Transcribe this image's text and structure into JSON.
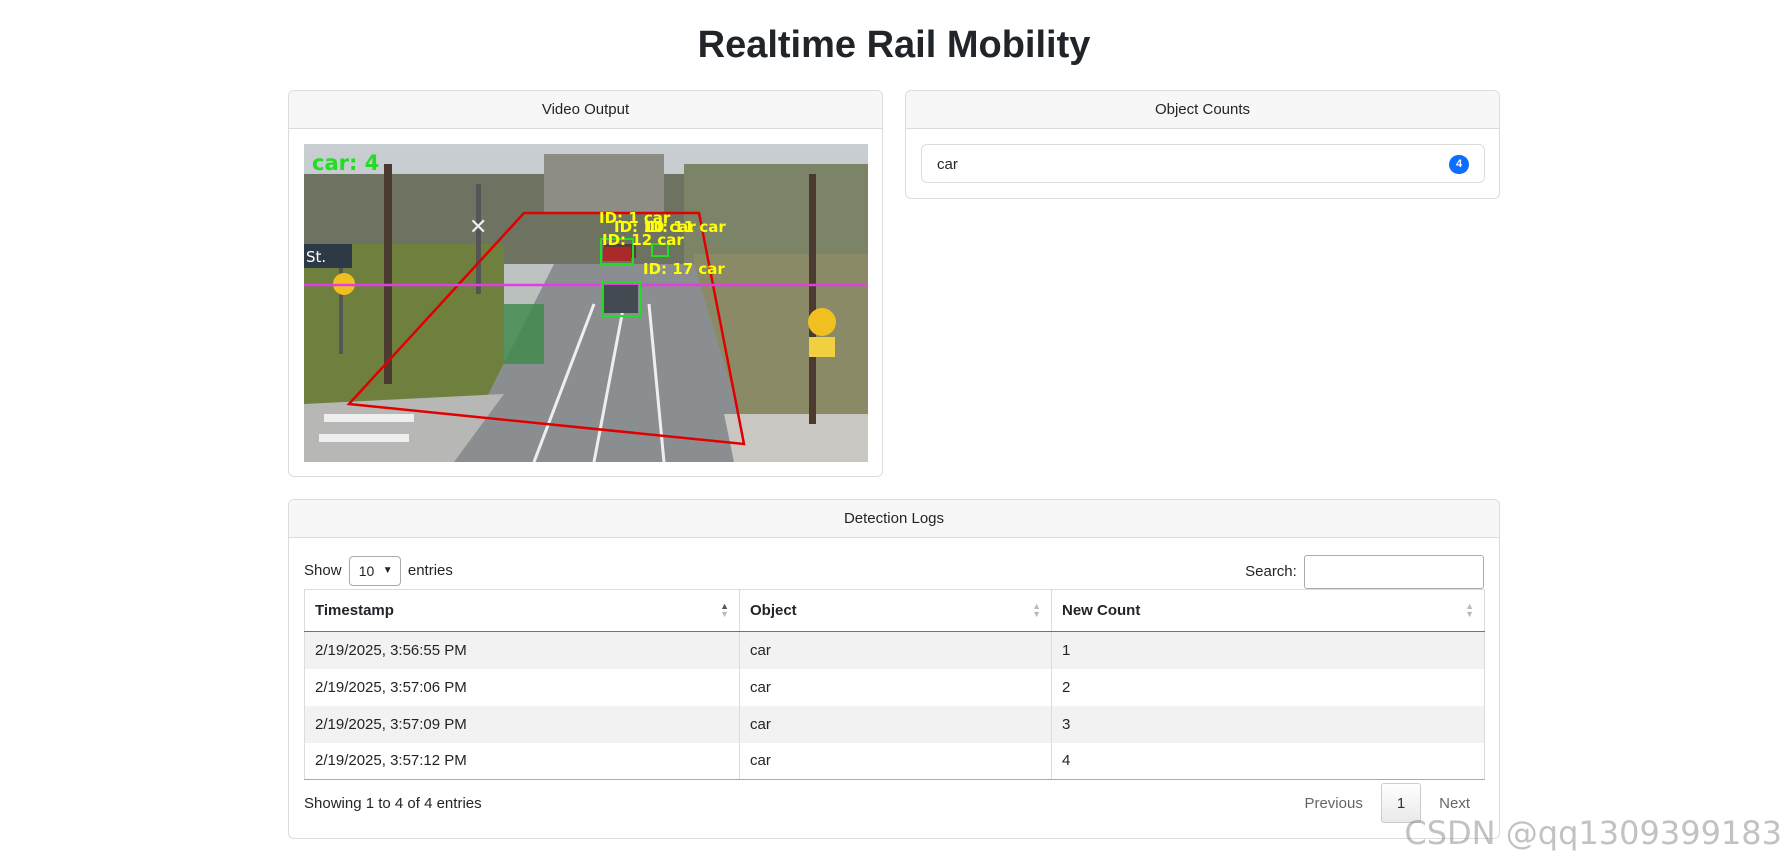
{
  "page": {
    "title": "Realtime Rail Mobility"
  },
  "video": {
    "header": "Video Output",
    "overlay": {
      "total_label": "car: 4",
      "detections": [
        "ID: 1 car",
        "ID: 10 car",
        "ID: 11 car",
        "ID: 12 car",
        "ID: 17 car"
      ],
      "sign_text": "St."
    }
  },
  "counts": {
    "header": "Object Counts",
    "items": [
      {
        "label": "car",
        "count": "4"
      }
    ]
  },
  "logs": {
    "header": "Detection Logs",
    "show_label": "Show",
    "length_value": "10",
    "entries_label": "entries",
    "search_label": "Search:",
    "search_value": "",
    "columns": [
      "Timestamp",
      "Object",
      "New Count"
    ],
    "rows": [
      [
        "2/19/2025, 3:56:55 PM",
        "car",
        "1"
      ],
      [
        "2/19/2025, 3:57:06 PM",
        "car",
        "2"
      ],
      [
        "2/19/2025, 3:57:09 PM",
        "car",
        "3"
      ],
      [
        "2/19/2025, 3:57:12 PM",
        "car",
        "4"
      ]
    ],
    "info": "Showing 1 to 4 of 4 entries",
    "pagination": {
      "previous": "Previous",
      "current": "1",
      "next": "Next"
    }
  },
  "watermark": "CSDN @qq1309399183",
  "colors": {
    "accent": "#0d6efd",
    "roi": "#e00000",
    "line": "#e040e0",
    "box": "#22dd22",
    "label": "#ffff00"
  }
}
